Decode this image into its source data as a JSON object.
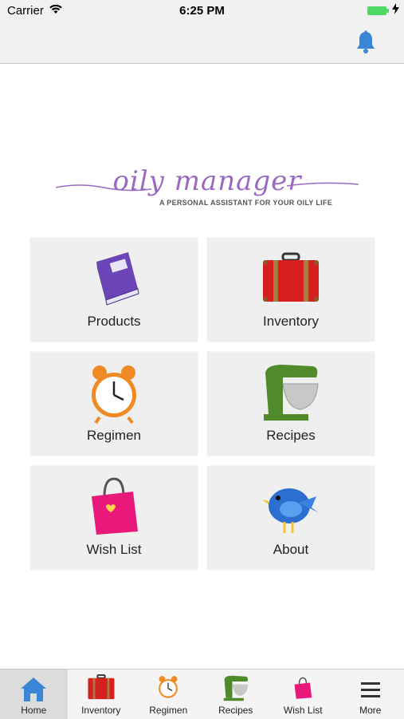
{
  "status_bar": {
    "carrier": "Carrier",
    "time": "6:25 PM"
  },
  "nav": {
    "bell_icon": "bell-icon"
  },
  "logo": {
    "title": "oily manager",
    "subtitle": "A PERSONAL ASSISTANT  FOR YOUR OILY LIFE"
  },
  "tiles": [
    {
      "label": "Products",
      "icon": "book-icon"
    },
    {
      "label": "Inventory",
      "icon": "suitcase-icon"
    },
    {
      "label": "Regimen",
      "icon": "alarm-clock-icon"
    },
    {
      "label": "Recipes",
      "icon": "stand-mixer-icon"
    },
    {
      "label": "Wish List",
      "icon": "shopping-bag-icon"
    },
    {
      "label": "About",
      "icon": "bluebird-icon"
    }
  ],
  "tab_bar": [
    {
      "label": "Home",
      "icon": "home-icon",
      "active": true
    },
    {
      "label": "Inventory",
      "icon": "suitcase-icon"
    },
    {
      "label": "Regimen",
      "icon": "alarm-clock-icon"
    },
    {
      "label": "Recipes",
      "icon": "stand-mixer-icon"
    },
    {
      "label": "Wish List",
      "icon": "shopping-bag-icon"
    },
    {
      "label": "More",
      "icon": "menu-icon"
    }
  ],
  "colors": {
    "accent": "#3a86d6",
    "logo": "#9a6ac3",
    "tile": "#efefef"
  }
}
